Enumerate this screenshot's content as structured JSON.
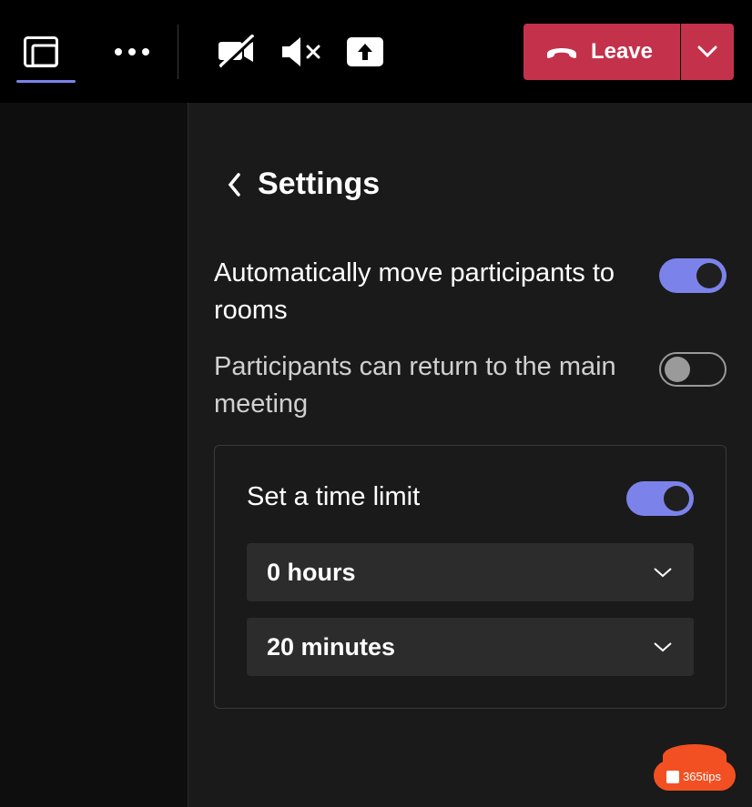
{
  "topbar": {
    "leave_label": "Leave"
  },
  "panel": {
    "title": "Settings",
    "auto_move_label": "Automatically move participants to rooms",
    "return_main_label": "Participants can return to the main meeting",
    "time_limit_title": "Set a time limit",
    "hours_value": "0 hours",
    "minutes_value": "20 minutes"
  },
  "watermark": {
    "text": "365tips"
  }
}
